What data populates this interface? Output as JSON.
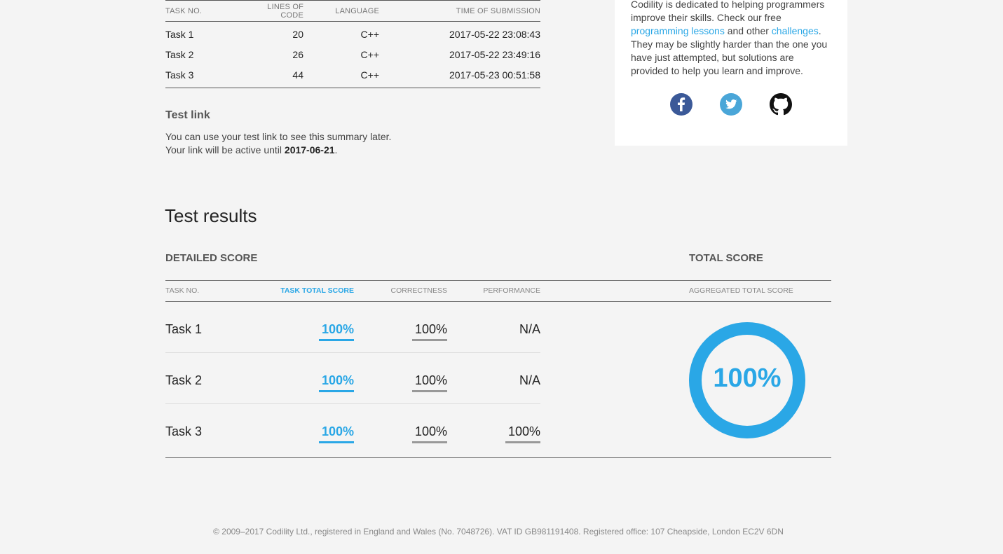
{
  "submissions": {
    "headers": [
      "TASK NO.",
      "LINES OF CODE",
      "LANGUAGE",
      "TIME OF SUBMISSION"
    ],
    "rows": [
      {
        "task": "Task 1",
        "loc": "20",
        "lang": "C++",
        "time": "2017-05-22 23:08:43"
      },
      {
        "task": "Task 2",
        "loc": "26",
        "lang": "C++",
        "time": "2017-05-22 23:49:16"
      },
      {
        "task": "Task 3",
        "loc": "44",
        "lang": "C++",
        "time": "2017-05-23 00:51:58"
      }
    ]
  },
  "test_link": {
    "title": "Test link",
    "line1": "You can use your test link to see this summary later.",
    "line2_prefix": "Your link will be active until ",
    "date": "2017-06-21",
    "line2_suffix": "."
  },
  "card": {
    "text_top": "Codility is dedicated to helping programmers improve their skills. Check our free",
    "link1": "programming lessons",
    "mid": "and other",
    "link2": "challenges",
    "text_bottom": "They may be slightly harder than the one you have just attempted, but solutions are provided to help you learn and improve.",
    "social": [
      "facebook-icon",
      "twitter-icon",
      "github-icon"
    ],
    "colors": {
      "facebook": "#3b5998",
      "twitter": "#4aa6d8",
      "github": "#111111"
    }
  },
  "results": {
    "title": "Test results",
    "detailed_heading": "DETAILED SCORE",
    "total_heading": "TOTAL SCORE",
    "headers": {
      "task": "TASK NO.",
      "total": "TASK TOTAL SCORE",
      "correctness": "CORRECTNESS",
      "performance": "PERFORMANCE",
      "aggregated": "AGGREGATED TOTAL SCORE"
    },
    "rows": [
      {
        "task": "Task 1",
        "total": "100%",
        "correctness": "100%",
        "performance": "N/A"
      },
      {
        "task": "Task 2",
        "total": "100%",
        "correctness": "100%",
        "performance": "N/A"
      },
      {
        "task": "Task 3",
        "total": "100%",
        "correctness": "100%",
        "performance": "100%"
      }
    ],
    "aggregated": "100%",
    "aggregated_fraction": 1.0,
    "accent_color": "#2aa7e6"
  },
  "footer": {
    "text": "© 2009–2017 Codility Ltd., registered in England and Wales (No. 7048726). VAT ID GB981191408. Registered office: 107 Cheapside, London EC2V 6DN"
  }
}
